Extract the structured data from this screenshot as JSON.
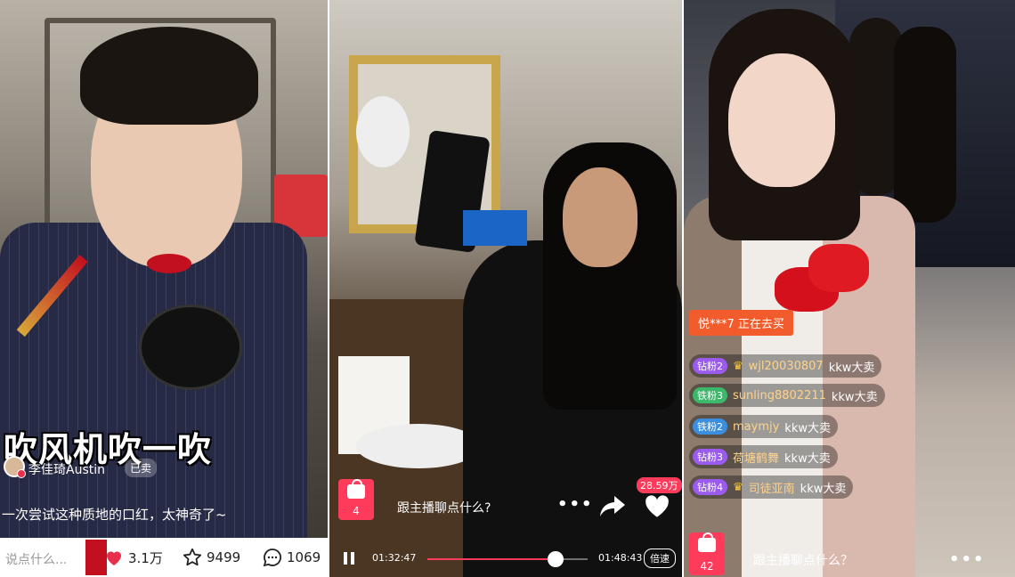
{
  "panel1": {
    "caption": "吹风机吹一吹",
    "author": "李佳琦Austin",
    "sold_badge": "已卖",
    "description": "一次尝试这种质地的口红，太神奇了~",
    "input_placeholder": "说点什么...",
    "likes": "3.1万",
    "favorites": "9499",
    "comments": "1069",
    "accent": "#e8304a"
  },
  "panel2": {
    "cart_count": "4",
    "chat_prompt": "跟主播聊点什么?",
    "like_count": "28.59万",
    "time_current": "01:32:47",
    "time_total": "01:48:43",
    "progress": 0.8,
    "speed_label": "倍速",
    "accent": "#ff3b5c"
  },
  "panel3": {
    "notice": "悦***7 正在去买",
    "messages": [
      {
        "level": "钻粉2",
        "level_color": "#9c5bf0",
        "crown": true,
        "user": "wjl20030807",
        "text": "kkw大卖"
      },
      {
        "level": "铁粉3",
        "level_color": "#3bb86a",
        "crown": false,
        "user": "sunling8802211",
        "text": "kkw大卖"
      },
      {
        "level": "铁粉2",
        "level_color": "#3a8fe0",
        "crown": false,
        "user": "maymjy",
        "text": "kkw大卖"
      },
      {
        "level": "钻粉3",
        "level_color": "#9c5bf0",
        "crown": false,
        "user": "荷塘鹤舞",
        "text": "kkw大卖"
      },
      {
        "level": "钻粉4",
        "level_color": "#9c5bf0",
        "crown": true,
        "user": "司徒亚南",
        "text": "kkw大卖"
      }
    ],
    "cart_count": "42",
    "chat_prompt": "跟主播聊点什么？",
    "accent": "#f25c2d"
  }
}
